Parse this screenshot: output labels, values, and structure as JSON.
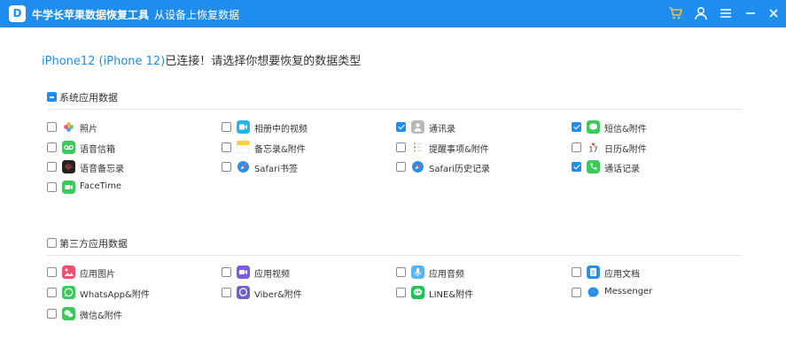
{
  "titlebar": {
    "logo_letter": "D",
    "app_name": "牛学长苹果数据恢复工具",
    "separator": "-",
    "subtitle": "从设备上恢复数据",
    "color": "#1e8df0"
  },
  "status": {
    "device": "iPhone12 (iPhone 12)",
    "message": "已连接！请选择你想要恢复的数据类型"
  },
  "sections": {
    "system": {
      "label": "系统应用数据",
      "state": "partial",
      "items": [
        {
          "label": "照片",
          "checked": false,
          "icon": "photos-icon"
        },
        {
          "label": "相册中的视频",
          "checked": false,
          "icon": "album-video-icon"
        },
        {
          "label": "通讯录",
          "checked": true,
          "icon": "contacts-icon"
        },
        {
          "label": "短信&附件",
          "checked": true,
          "icon": "messages-icon"
        },
        {
          "label": "语音信箱",
          "checked": false,
          "icon": "voicemail-icon"
        },
        {
          "label": "备忘录&附件",
          "checked": false,
          "icon": "notes-icon"
        },
        {
          "label": "提醒事项&附件",
          "checked": false,
          "icon": "reminders-icon"
        },
        {
          "label": "日历&附件",
          "checked": false,
          "icon": "calendar-icon"
        },
        {
          "label": "语音备忘录",
          "checked": false,
          "icon": "voice-memos-icon"
        },
        {
          "label": "Safari书签",
          "checked": false,
          "icon": "safari-icon"
        },
        {
          "label": "Safari历史记录",
          "checked": false,
          "icon": "safari-history-icon"
        },
        {
          "label": "通话记录",
          "checked": true,
          "icon": "phone-icon"
        },
        {
          "label": "FaceTime",
          "checked": false,
          "icon": "facetime-icon"
        }
      ]
    },
    "third_party": {
      "label": "第三方应用数据",
      "state": "unchecked",
      "items": [
        {
          "label": "应用图片",
          "checked": false,
          "icon": "app-photos-icon"
        },
        {
          "label": "应用视频",
          "checked": false,
          "icon": "app-video-icon"
        },
        {
          "label": "应用音频",
          "checked": false,
          "icon": "app-audio-icon"
        },
        {
          "label": "应用文档",
          "checked": false,
          "icon": "app-docs-icon"
        },
        {
          "label": "WhatsApp&附件",
          "checked": false,
          "icon": "whatsapp-icon"
        },
        {
          "label": "Viber&附件",
          "checked": false,
          "icon": "viber-icon"
        },
        {
          "label": "LINE&附件",
          "checked": false,
          "icon": "line-icon"
        },
        {
          "label": "Messenger",
          "checked": false,
          "icon": "messenger-icon"
        },
        {
          "label": "微信&附件",
          "checked": false,
          "icon": "wechat-icon"
        }
      ]
    }
  }
}
